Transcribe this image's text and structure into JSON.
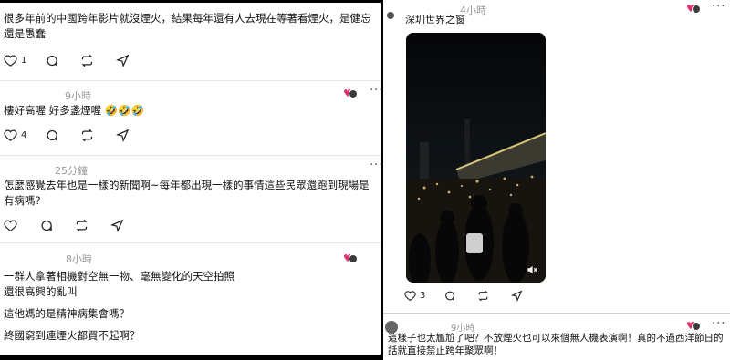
{
  "left": {
    "posts": [
      {
        "text": "很多年前的中國跨年影片就沒煙火，結果每年還有人去現在等著看煙火，是健忘還是愚蠢",
        "likes": "1"
      },
      {
        "time": "9小時",
        "text": "樓好高喔 好多盞煙喔 🤣🤣🤣",
        "likes": "4"
      },
      {
        "time": "25分鐘",
        "text": "怎麼感覺去年也是一樣的新聞啊~每年都出現一樣的事情這些民眾還跑到現場是有病嗎?"
      },
      {
        "time": "8小時",
        "lines": [
          "一群人拿著相機對空無一物、毫無變化的天空拍照",
          "還很高興的亂叫",
          "這他媽的是精神病集會嗎？",
          "終國窮到連煙火都買不起啊？"
        ]
      }
    ]
  },
  "right": {
    "top_time": "4小時",
    "location": "深圳世界之窗",
    "video_likes": "3",
    "reply": {
      "time": "9小時",
      "text": "這樣子也太尷尬了吧？不放煙火也可以來個無人機表演啊！真的不過西洋節日的話就直接禁止跨年聚眾啊！"
    }
  },
  "icons": {
    "heart": "heart-icon",
    "comment": "comment-icon",
    "repost": "repost-icon",
    "share": "share-icon",
    "more": "more-icon",
    "mute": "mute-icon"
  },
  "colors": {
    "like_badge": "#e1306c",
    "time": "#999999"
  }
}
